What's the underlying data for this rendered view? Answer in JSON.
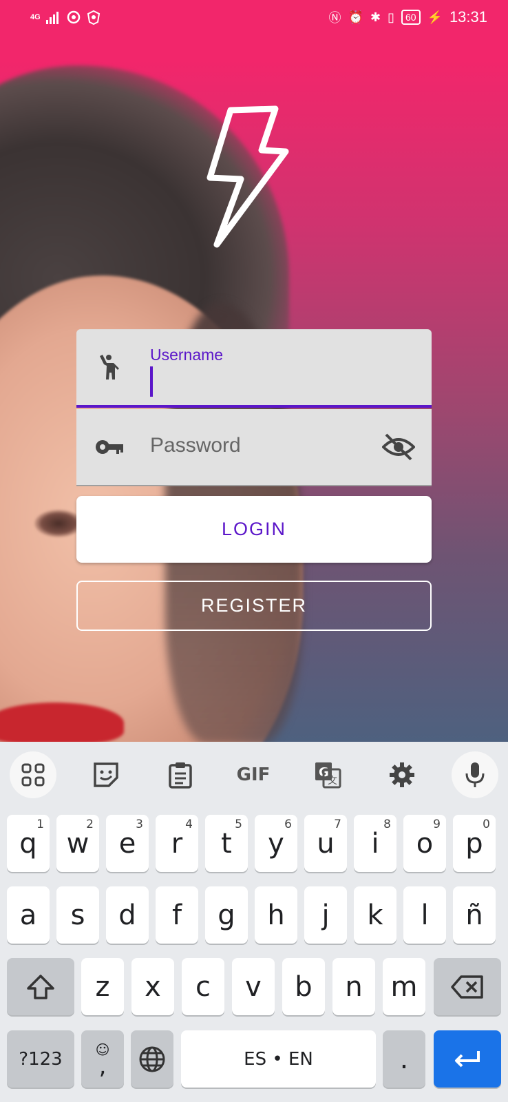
{
  "status_bar": {
    "network": "4G",
    "time": "13:31",
    "battery": "60"
  },
  "form": {
    "username_label": "Username",
    "password_placeholder": "Password",
    "login_label": "LOGIN",
    "register_label": "REGISTER"
  },
  "colors": {
    "accent": "#5b16c9",
    "brand_top": "#f2266b",
    "keyboard_blue": "#1a73e8"
  },
  "keyboard": {
    "toolbar": {
      "gif_label": "GIF"
    },
    "row1": [
      {
        "key": "q",
        "num": "1"
      },
      {
        "key": "w",
        "num": "2"
      },
      {
        "key": "e",
        "num": "3"
      },
      {
        "key": "r",
        "num": "4"
      },
      {
        "key": "t",
        "num": "5"
      },
      {
        "key": "y",
        "num": "6"
      },
      {
        "key": "u",
        "num": "7"
      },
      {
        "key": "i",
        "num": "8"
      },
      {
        "key": "o",
        "num": "9"
      },
      {
        "key": "p",
        "num": "0"
      }
    ],
    "row2": [
      "a",
      "s",
      "d",
      "f",
      "g",
      "h",
      "j",
      "k",
      "l",
      "ñ"
    ],
    "row3": [
      "z",
      "x",
      "c",
      "v",
      "b",
      "n",
      "m"
    ],
    "symbols_label": "?123",
    "comma_label": ",",
    "space_label": "ES • EN",
    "period_label": "."
  }
}
